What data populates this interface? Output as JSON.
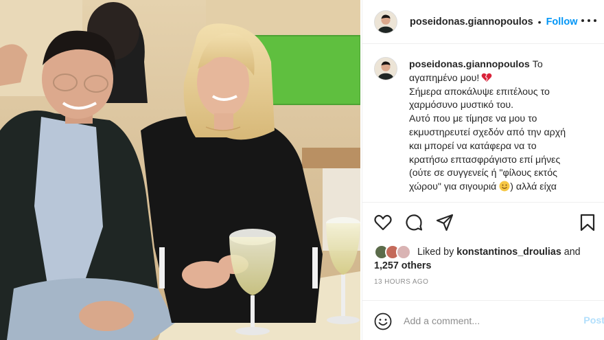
{
  "post": {
    "username": "poseidonas.giannopoulos",
    "follow_label": "Follow",
    "separator": "•",
    "more_icon": "more-options-icon"
  },
  "caption": {
    "username": "poseidonas.giannopoulos",
    "lines": [
      "Το",
      "αγαπημένο μου!",
      "Σήμερα αποκάλυψε επιτέλους το",
      "χαρμόσυνο μυστικό του.",
      "Αυτό που με τίμησε να μου το",
      "εκμυστηρευτεί σχεδόν από την αρχή",
      "και μπορεί να κατάφερα να το",
      "κρατήσω επτασφράγιστο επί μήνες",
      "(ούτε σε συγγενείς ή \"φίλους εκτός",
      "χώρου\" για σιγουριά",
      ") αλλά είχα"
    ]
  },
  "actions": {
    "like_icon": "heart-icon",
    "comment_icon": "comment-icon",
    "share_icon": "share-icon",
    "save_icon": "bookmark-icon"
  },
  "likes": {
    "prefix": "Liked by",
    "user": "konstantinos_droulias",
    "and": "and",
    "others": "1,257 others"
  },
  "timestamp": "13 HOURS AGO",
  "comment_box": {
    "placeholder": "Add a comment...",
    "post_label": "Post"
  },
  "colors": {
    "accent": "#0095f6",
    "post_disabled": "#b2dffc",
    "heart_emoji": "#d9233a"
  }
}
